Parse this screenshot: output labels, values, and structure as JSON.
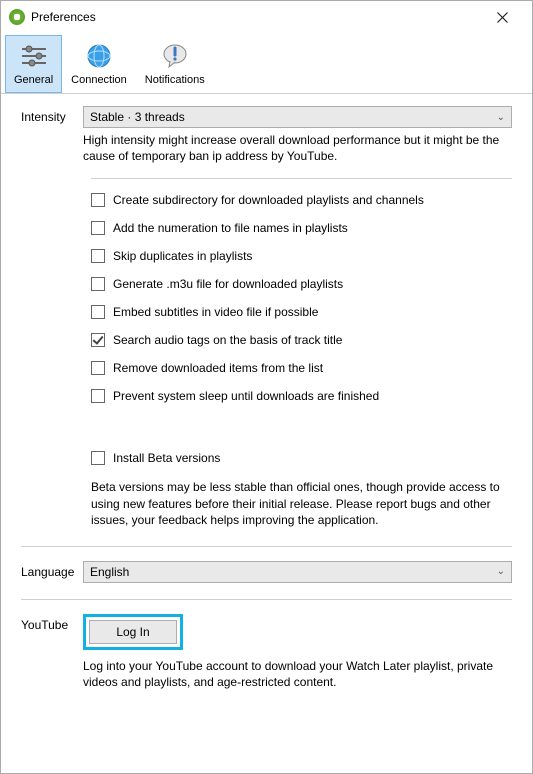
{
  "window": {
    "title": "Preferences"
  },
  "tabs": {
    "general": "General",
    "connection": "Connection",
    "notifications": "Notifications"
  },
  "intensity": {
    "label": "Intensity",
    "value": "Stable · 3 threads",
    "desc": "High intensity might increase overall download performance but it might be the cause of temporary ban ip address by YouTube."
  },
  "checks": {
    "c1": "Create subdirectory for downloaded playlists and channels",
    "c2": "Add the numeration to file names in playlists",
    "c3": "Skip duplicates in playlists",
    "c4": "Generate .m3u file for downloaded playlists",
    "c5": "Embed subtitles in video file if possible",
    "c6": "Search audio tags on the basis of track title",
    "c7": "Remove downloaded items from the list",
    "c8": "Prevent system sleep until downloads are finished"
  },
  "beta": {
    "label": "Install Beta versions",
    "desc": "Beta versions may be less stable than official ones, though provide access to using new features before their initial release. Please report bugs and other issues, your feedback helps improving the application."
  },
  "language": {
    "label": "Language",
    "value": "English"
  },
  "youtube": {
    "label": "YouTube",
    "button": "Log In",
    "desc": "Log into your YouTube account to download your Watch Later playlist, private videos and playlists, and age-restricted content."
  }
}
